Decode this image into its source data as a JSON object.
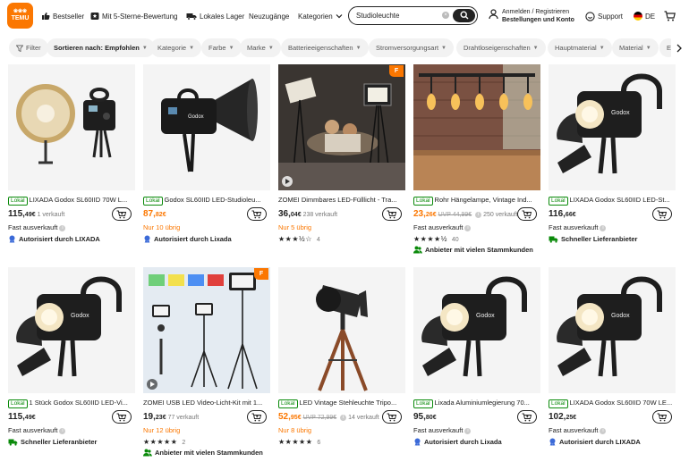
{
  "header": {
    "logo_text": "TEMU",
    "nav": [
      {
        "label": "Bestseller",
        "icon": "thumbs-up-icon"
      },
      {
        "label": "Mit 5-Sterne-Bewertung",
        "icon": "star-icon"
      },
      {
        "label": "Lokales Lager",
        "icon": "truck-icon"
      },
      {
        "label": "Neuzugänge"
      },
      {
        "label": "Kategorien"
      }
    ],
    "search_value": "Studioleuchte",
    "account_line1": "Anmelden / Registrieren",
    "account_line2": "Bestellungen und Konto",
    "support": "Support",
    "language": "DE",
    "brand_color": "#fb7701"
  },
  "filters": {
    "filter_label": "Filter",
    "sort_label": "Sortieren nach: Empfohlen",
    "chips": [
      "Kategorie",
      "Farbe",
      "Marke",
      "Batterieeigenschaften",
      "Stromversorgungsart",
      "Drahtloseigenschaften",
      "Hauptmaterial",
      "Material",
      "E"
    ]
  },
  "products": [
    {
      "lokal": "Lokal",
      "title": "LIXADA Godox SL60IID 70W L...",
      "price_int": "115,",
      "price_dec": "49",
      "currency": "€",
      "extra": "1 verkauft",
      "line2": "Fast ausverkauft",
      "line3": "Autorisiert durch LIXADA",
      "line3_icon": "authorized-badge-icon"
    },
    {
      "lokal": "Lokal",
      "title": "Godox SL60IID LED-Studioleu...",
      "price_int": "87,",
      "price_dec": "82",
      "currency": "€",
      "price_orange": true,
      "line2": "Nur 10 übrig",
      "line2_orange": true,
      "line3": "Autorisiert durch Lixada",
      "line3_icon": "authorized-badge-icon"
    },
    {
      "title": "ZOMEI Dimmbares LED-Fülllicht - Tra...",
      "price_int": "36,",
      "price_dec": "04",
      "currency": "€",
      "extra": "238 verkauft",
      "line2": "Nur 5 übrig",
      "line2_orange": true,
      "stars": "★★★½☆",
      "rating": 3.5,
      "reviews": "4",
      "badge": "F"
    },
    {
      "lokal": "Lokal",
      "title": "Rohr Hängelampe, Vintage Ind...",
      "price_int": "23,",
      "price_dec": "26",
      "currency": "€",
      "price_orange": true,
      "uvp": "UVP 44,99€",
      "extra": "250 verkauft",
      "line2": "Fast ausverkauft",
      "stars": "★★★★½",
      "rating": 4.5,
      "reviews": "40",
      "line3": "Anbieter mit vielen Stammkunden",
      "line3_icon": "users-icon"
    },
    {
      "lokal": "Lokal",
      "title": "LIXADA Godox SL60IID LED-St...",
      "price_int": "116,",
      "price_dec": "66",
      "currency": "€",
      "line2": "Fast ausverkauft",
      "line3": "Schneller Lieferanbieter",
      "line3_icon": "truck-icon"
    },
    {
      "lokal": "Lokal",
      "title": "1 Stück Godox SL60IID LED-Vi...",
      "price_int": "115,",
      "price_dec": "49",
      "currency": "€",
      "line2": "Fast ausverkauft",
      "line3": "Schneller Lieferanbieter",
      "line3_icon": "truck-icon"
    },
    {
      "title": "ZOMEI USB LED Video-Licht-Kit mit 1...",
      "price_int": "19,",
      "price_dec": "23",
      "currency": "€",
      "extra": "77 verkauft",
      "line2": "Nur 12 übrig",
      "line2_orange": true,
      "stars": "★★★★★",
      "rating": 5,
      "reviews": "2",
      "line3": "Anbieter mit vielen Stammkunden",
      "line3_icon": "users-icon",
      "badge": "F"
    },
    {
      "lokal": "Lokal",
      "title": "LED Vintage Stehleuchte Tripo...",
      "price_int": "52,",
      "price_dec": "95",
      "currency": "€",
      "price_orange": true,
      "uvp": "UVP 72,99€",
      "extra": "14 verkauft",
      "line2": "Nur 8 übrig",
      "line2_orange": true,
      "stars": "★★★★★",
      "rating": 5,
      "reviews": "6"
    },
    {
      "lokal": "Lokal",
      "title": "Lixada Aluminiumlegierung 70...",
      "price_int": "95,",
      "price_dec": "80",
      "currency": "€",
      "line2": "Fast ausverkauft",
      "line3": "Autorisiert durch Lixada",
      "line3_icon": "authorized-badge-icon"
    },
    {
      "lokal": "Lokal",
      "title": "LIXADA Godox SL60IID 70W LE...",
      "price_int": "102,",
      "price_dec": "25",
      "currency": "€",
      "line2": "Fast ausverkauft",
      "line3": "Autorisiert durch LIXADA",
      "line3_icon": "authorized-badge-icon"
    }
  ]
}
